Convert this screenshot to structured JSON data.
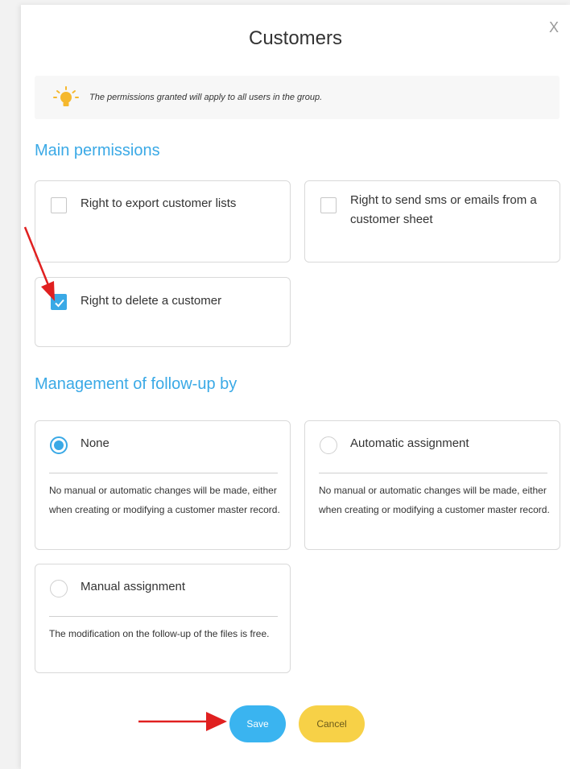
{
  "modal": {
    "title": "Customers",
    "close_label": "X"
  },
  "info": {
    "text": "The permissions granted will apply to all users in the group."
  },
  "main_permissions": {
    "title": "Main permissions",
    "items": [
      {
        "label": "Right to export customer lists",
        "checked": false
      },
      {
        "label": "Right to send sms or emails from a customer sheet",
        "checked": false
      },
      {
        "label": "Right to delete a customer",
        "checked": true
      }
    ]
  },
  "followup": {
    "title": "Management of follow-up by",
    "options": [
      {
        "label": "None",
        "selected": true,
        "description": "No manual or automatic changes will be made, either when creating or modifying a customer master record."
      },
      {
        "label": "Automatic assignment",
        "selected": false,
        "description": "No manual or automatic changes will be made, either when creating or modifying a customer master record."
      },
      {
        "label": "Manual assignment",
        "selected": false,
        "description": "The modification on the follow-up of the files is free."
      }
    ]
  },
  "buttons": {
    "save": "Save",
    "cancel": "Cancel"
  },
  "colors": {
    "accent": "#3aa9e6",
    "save": "#3ab4f0",
    "cancel": "#f7d147",
    "annotation_arrow": "#e02020"
  }
}
